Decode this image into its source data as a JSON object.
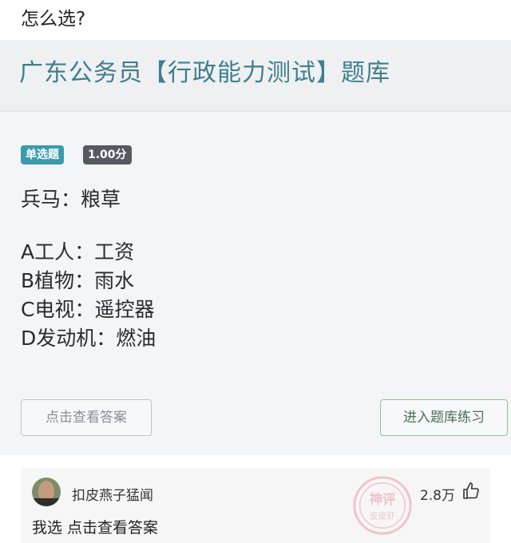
{
  "post": {
    "question": "怎么选?"
  },
  "screenshot": {
    "title": "广东公务员【行政能力测试】题库",
    "question_type": "单选题",
    "score": "1.00分",
    "stem": "兵马：粮草",
    "options": [
      "A工人：工资",
      "B植物：雨水",
      "C电视：遥控器",
      "D发动机：燃油"
    ],
    "view_answer_button": "点击查看答案",
    "practice_button": "进入题库练习"
  },
  "comment": {
    "username": "扣皮燕子猛闻",
    "text": "我选 点击查看答案",
    "likes": "2.8万",
    "icons": {
      "like": "thumbs-up-icon",
      "avatar": "user-avatar"
    },
    "stamp": {
      "top": "神评",
      "bottom": "皮皮虾"
    }
  },
  "colors": {
    "title": "#3f7e8e",
    "tag_type": "#3b9bab",
    "tag_score": "#555a60",
    "stamp": "#e0506a"
  }
}
